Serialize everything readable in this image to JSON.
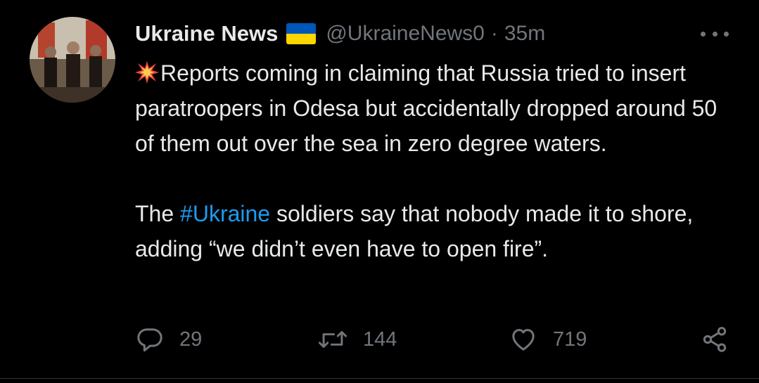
{
  "tweet": {
    "author": {
      "name": "Ukraine News",
      "handle": "@UkraineNews0",
      "flag_colors": [
        "#0057b7",
        "#ffd500"
      ]
    },
    "separator": "·",
    "timestamp": "35m",
    "more_icon": "more-horizontal-icon",
    "paragraph1": "Reports coming in claiming that  Russia tried to insert paratroopers in Odesa but accidentally dropped around 50 of them out over the sea in zero degree waters.",
    "paragraph2_before": "The ",
    "hashtag": "#Ukraine",
    "paragraph2_after": " soldiers say that nobody made it to shore, adding “we didn’t even have to open fire”.",
    "emoji": "collision-emoji"
  },
  "actions": {
    "reply": {
      "icon": "reply-icon",
      "count": "29"
    },
    "retweet": {
      "icon": "retweet-icon",
      "count": "144"
    },
    "like": {
      "icon": "heart-icon",
      "count": "719"
    },
    "share": {
      "icon": "share-icon"
    }
  },
  "colors": {
    "background": "#000000",
    "text": "#e7e9ea",
    "secondary": "#71767b",
    "link": "#1d9bf0"
  }
}
